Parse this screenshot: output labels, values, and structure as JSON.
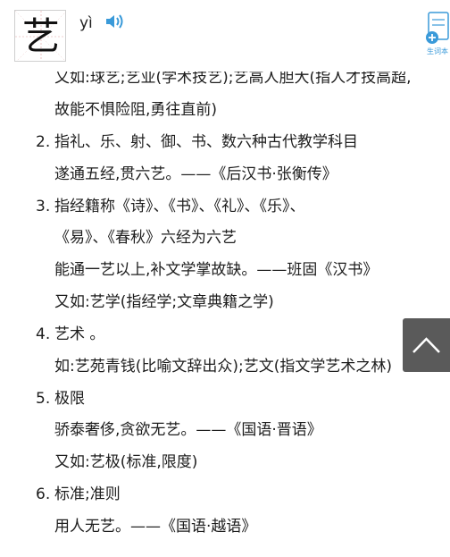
{
  "header": {
    "character": "艺",
    "pinyin": "yì",
    "add_vocab_label": "生词本"
  },
  "definitions": [
    {
      "num": "",
      "lines": [
        "又如:球艺;艺业(学术技艺);艺高人胆大(指人才技高超,",
        "故能不惧险阻,勇往直前)"
      ]
    },
    {
      "num": "2.",
      "lines": [
        "指礼、乐、射、御、书、数六种古代教学科目",
        "遂通五经,贯六艺。——《后汉书·张衡传》"
      ]
    },
    {
      "num": "3.",
      "lines": [
        "指经籍称《诗》、《书》、《礼》、《乐》、",
        "《易》、《春秋》六经为六艺",
        "能通一艺以上,补文学掌故缺。——班固《汉书》",
        "又如:艺学(指经学;文章典籍之学)"
      ]
    },
    {
      "num": "4.",
      "lines": [
        "艺术 。",
        "如:艺苑青钱(比喻文辞出众);艺文(指文学艺术之林)"
      ]
    },
    {
      "num": "5.",
      "lines": [
        "极限",
        "骄泰奢侈,贪欲无艺。——《国语·晋语》",
        "又如:艺极(标准,限度)"
      ]
    },
    {
      "num": "6.",
      "lines": [
        "标准;准则",
        "用人无艺。——《国语·越语》"
      ]
    }
  ],
  "colors": {
    "accent": "#3a9ad9",
    "scroll_button": "#5a5a5a"
  }
}
